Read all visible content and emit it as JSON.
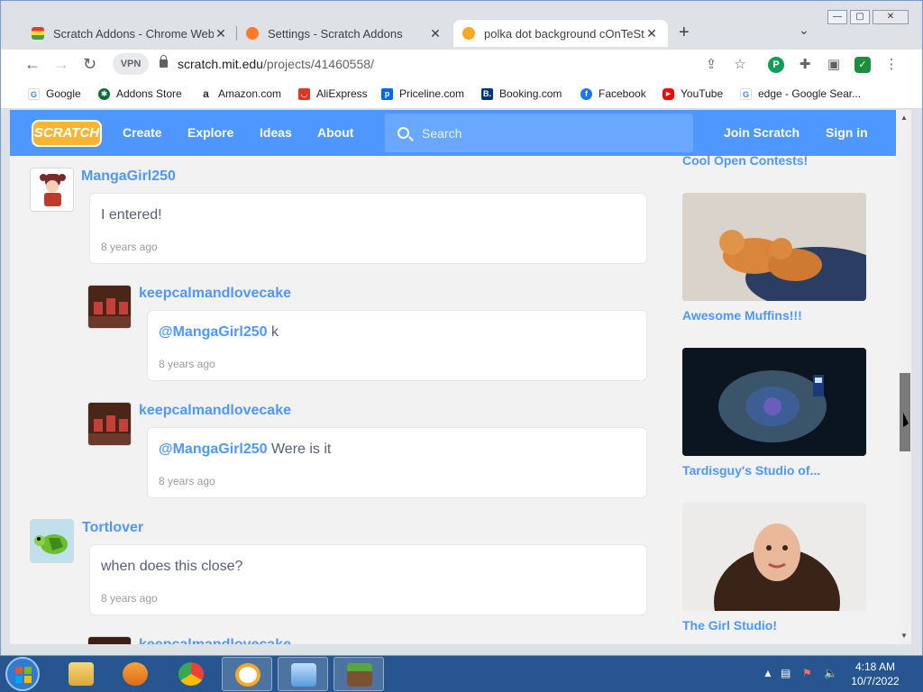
{
  "browser": {
    "tabs": [
      {
        "title": "Scratch Addons - Chrome Web S",
        "active": false,
        "favicon_color": "#e34c26"
      },
      {
        "title": "Settings - Scratch Addons",
        "active": false,
        "favicon_color": "#ff7b26"
      },
      {
        "title": "polka dot background cOnTeSt rc",
        "active": true,
        "favicon_color": "#f9a825"
      }
    ],
    "new_tab_label": "+",
    "tab_menu_label": "⌄",
    "window_controls": {
      "minimize": "—",
      "maximize": "▢",
      "close": "✕"
    },
    "vpn_badge": "VPN",
    "url_domain": "scratch.mit.edu",
    "url_path": "/projects/41460558/",
    "bookmarks": [
      {
        "label": "Google",
        "icon": "google-icon",
        "color": "#4285f4"
      },
      {
        "label": "Addons Store",
        "icon": "addons-store-icon",
        "color": "#0f6b3c"
      },
      {
        "label": "Amazon.com",
        "icon": "amazon-icon",
        "color": "#232f3e"
      },
      {
        "label": "AliExpress",
        "icon": "aliexpress-icon",
        "color": "#e43225"
      },
      {
        "label": "Priceline.com",
        "icon": "priceline-icon",
        "color": "#0068ef"
      },
      {
        "label": "Booking.com",
        "icon": "booking-icon",
        "color": "#003580"
      },
      {
        "label": "Facebook",
        "icon": "facebook-icon",
        "color": "#1877f2"
      },
      {
        "label": "YouTube",
        "icon": "youtube-icon",
        "color": "#ff0000"
      },
      {
        "label": "edge - Google Sear...",
        "icon": "google-icon",
        "color": "#4285f4"
      }
    ]
  },
  "scratch": {
    "logo": "SCRATCH",
    "nav": [
      "Create",
      "Explore",
      "Ideas",
      "About"
    ],
    "search_placeholder": "Search",
    "join": "Join Scratch",
    "signin": "Sign in",
    "accent": "#4d97ff"
  },
  "comments": [
    {
      "user": "MangaGirl250",
      "mention": "",
      "text": "I entered!",
      "time": "8 years ago",
      "reply": false
    },
    {
      "user": "keepcalmandlovecake",
      "mention": "@MangaGirl250",
      "text": " k",
      "time": "8 years ago",
      "reply": true
    },
    {
      "user": "keepcalmandlovecake",
      "mention": "@MangaGirl250",
      "text": " Were is it",
      "time": "8 years ago",
      "reply": true
    },
    {
      "user": "Tortlover",
      "mention": "",
      "text": "when does this close?",
      "time": "8 years ago",
      "reply": false
    },
    {
      "user": "keepcalmandlovecake",
      "mention": "",
      "text": "",
      "time": "",
      "reply": true
    }
  ],
  "studios": [
    {
      "title": "Cool Open Contests!"
    },
    {
      "title": "Awesome Muffins!!!"
    },
    {
      "title": "Tardisguy's Studio of..."
    },
    {
      "title": "The Girl Studio!"
    }
  ],
  "taskbar": {
    "time": "4:18 AM",
    "date": "10/7/2022",
    "apps": [
      "explorer-icon",
      "media-player-icon",
      "chrome-icon",
      "scratch-addons-icon",
      "control-panel-icon",
      "minecraft-icon"
    ]
  }
}
